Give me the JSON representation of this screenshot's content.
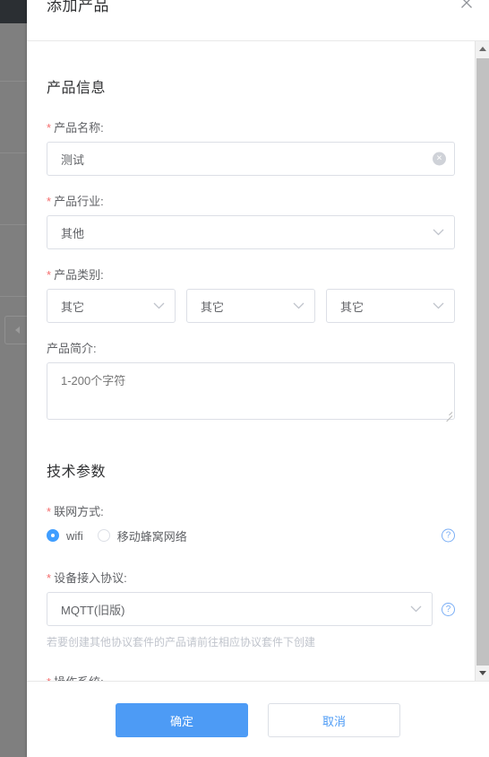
{
  "modal": {
    "title": "添加产品",
    "close_icon": "close-icon"
  },
  "sections": {
    "product_info": {
      "heading": "产品信息",
      "name": {
        "label": "产品名称:",
        "value": "测试",
        "clear_icon": "×"
      },
      "industry": {
        "label": "产品行业:",
        "value": "其他"
      },
      "category": {
        "label": "产品类别:",
        "values": [
          "其它",
          "其它",
          "其它"
        ]
      },
      "intro": {
        "label": "产品简介:",
        "placeholder": "1-200个字符",
        "value": ""
      }
    },
    "tech_params": {
      "heading": "技术参数",
      "network": {
        "label": "联网方式:",
        "options": [
          {
            "label": "wifi",
            "checked": true
          },
          {
            "label": "移动蜂窝网络",
            "checked": false
          }
        ],
        "help_icon": "?"
      },
      "protocol": {
        "label": "设备接入协议:",
        "value": "MQTT(旧版)",
        "help_icon": "?",
        "hint": "若要创建其他协议套件的产品请前往相应协议套件下创建"
      },
      "os": {
        "label": "操作系统:"
      }
    }
  },
  "footer": {
    "confirm_label": "确定",
    "cancel_label": "取消"
  },
  "scrollbar": {
    "up_arrow": "scroll-up-arrow",
    "down_arrow": "scroll-down-arrow"
  },
  "colors": {
    "primary": "#409eff",
    "button_primary": "#4d9bf5",
    "required": "#f56c6c",
    "border": "#dcdfe6",
    "text": "#606266"
  }
}
